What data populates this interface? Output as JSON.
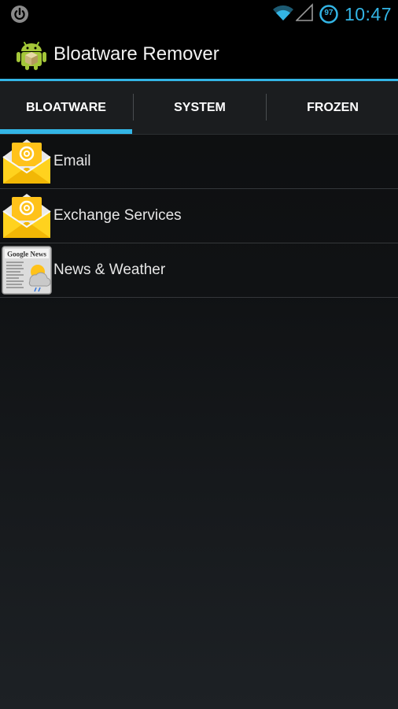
{
  "status_bar": {
    "left_icon": "power-icon",
    "wifi_icon": "wifi-icon",
    "signal_icon": "cell-signal-icon",
    "battery_level": "97",
    "time": "10:47",
    "accent_color": "#33b5e5"
  },
  "action_bar": {
    "app_icon": "android-box-icon",
    "title": "Bloatware Remover"
  },
  "tabs": [
    {
      "label": "BLOATWARE",
      "selected": true
    },
    {
      "label": "SYSTEM",
      "selected": false
    },
    {
      "label": "FROZEN",
      "selected": false
    }
  ],
  "apps": [
    {
      "name": "Email",
      "icon": "email-envelope-icon"
    },
    {
      "name": "Exchange Services",
      "icon": "email-envelope-icon"
    },
    {
      "name": "News & Weather",
      "icon": "google-news-icon"
    }
  ],
  "news_icon_text": "Google News"
}
